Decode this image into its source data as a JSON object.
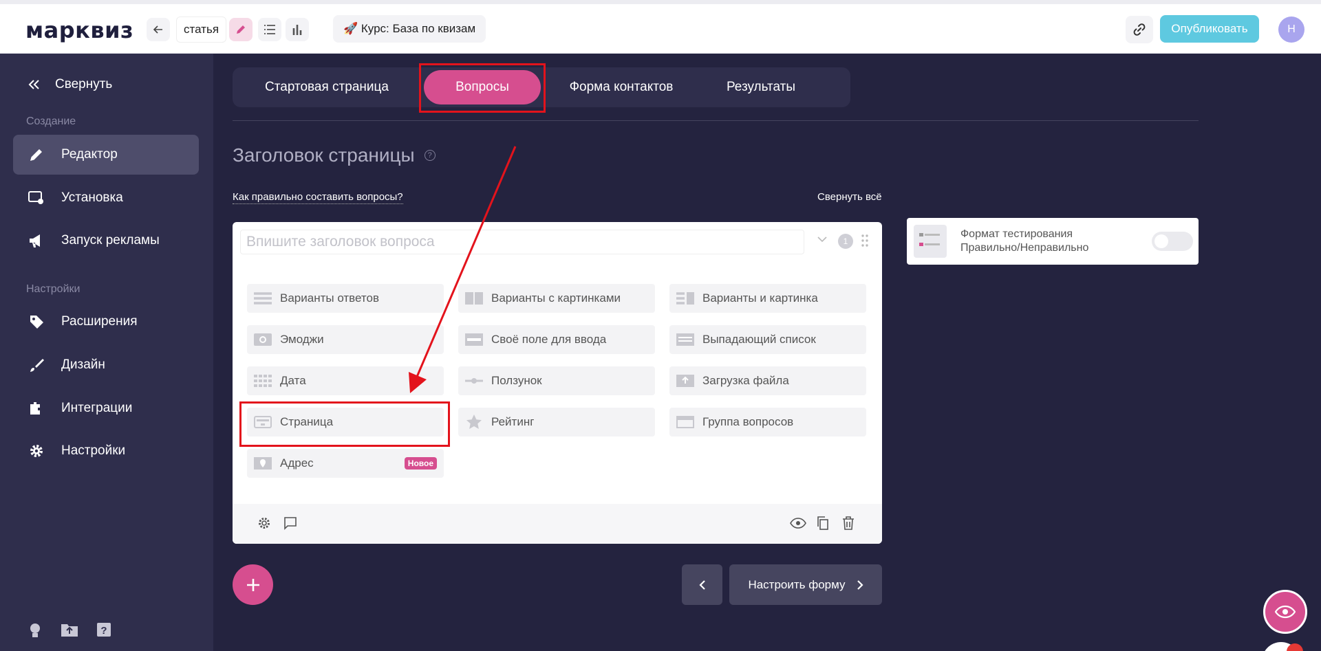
{
  "app": {
    "logo": "марквиз"
  },
  "topbar": {
    "quiz_name": "статья",
    "course_label": "🚀 Курс: База по квизам",
    "publish_label": "Опубликовать",
    "avatar_initial": "Н"
  },
  "sidebar": {
    "collapse_label": "Свернуть",
    "section_create": "Создание",
    "section_settings": "Настройки",
    "items": [
      {
        "label": "Редактор",
        "icon": "pencil-icon",
        "active": true
      },
      {
        "label": "Установка",
        "icon": "install-icon"
      },
      {
        "label": "Запуск рекламы",
        "icon": "megaphone-icon"
      },
      {
        "label": "Расширения",
        "icon": "tag-plus-icon"
      },
      {
        "label": "Дизайн",
        "icon": "brush-icon"
      },
      {
        "label": "Интеграции",
        "icon": "plugin-icon"
      },
      {
        "label": "Настройки",
        "icon": "gear-icon"
      }
    ]
  },
  "tabs": [
    {
      "label": "Стартовая страница"
    },
    {
      "label": "Вопросы",
      "active": true
    },
    {
      "label": "Форма контактов"
    },
    {
      "label": "Результаты"
    }
  ],
  "main": {
    "page_title": "Заголовок страницы",
    "how_to_link": "Как правильно составить вопросы?",
    "collapse_all": "Свернуть всё",
    "question_placeholder": "Впишите заголовок вопроса",
    "question_number": "1",
    "question_types": [
      {
        "label": "Варианты ответов",
        "icon": "list-icon"
      },
      {
        "label": "Варианты с картинками",
        "icon": "image-grid-icon"
      },
      {
        "label": "Варианты и картинка",
        "icon": "list-image-icon"
      },
      {
        "label": "Эмоджи",
        "icon": "emoji-icon"
      },
      {
        "label": "Своё поле для ввода",
        "icon": "text-field-icon"
      },
      {
        "label": "Выпадающий список",
        "icon": "dropdown-icon"
      },
      {
        "label": "Дата",
        "icon": "calendar-icon"
      },
      {
        "label": "Ползунок",
        "icon": "slider-icon"
      },
      {
        "label": "Загрузка файла",
        "icon": "upload-icon"
      },
      {
        "label": "Страница",
        "icon": "page-icon"
      },
      {
        "label": "Рейтинг",
        "icon": "star-icon"
      },
      {
        "label": "Группа вопросов",
        "icon": "group-icon"
      },
      {
        "label": "Адрес",
        "icon": "map-pin-icon",
        "badge": "Новое"
      }
    ],
    "side_option": {
      "line1": "Формат тестирования",
      "line2": "Правильно/Неправильно",
      "enabled": false
    },
    "next_label": "Настроить форму"
  },
  "colors": {
    "accent": "#d64e8f",
    "publish": "#5ec9e0",
    "bg": "#24233f",
    "sidebar": "#2f2e4c",
    "highlight": "#e3131c"
  }
}
